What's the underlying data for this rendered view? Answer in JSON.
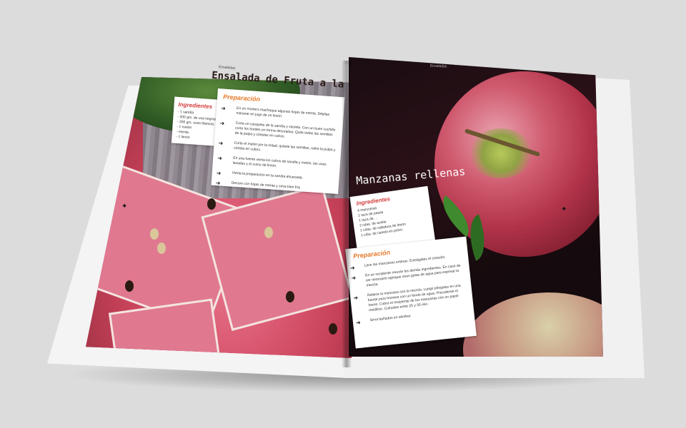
{
  "left_page": {
    "section_tag": "Ensaladas",
    "title": "Ensalada de Fruta a la Menta",
    "ingredients_heading": "Ingredientes",
    "ingredients": [
      "- 1 sandía",
      "- 200 grs. de uva negras",
      "- 200 grs. uvas blancas",
      "- 1 melón",
      "- menta",
      "- 1 limón"
    ],
    "preparation_heading": "Preparación",
    "steps": [
      "En un mortero machaque algunas hojas de menta. Déjelas macerar en jugo de un limón.",
      "Corte un casquete de la sandía y vacíela. Con un buen cuchillo corte los bordes en forma decorativa. Quite todas las semillas de la pulpa y córtelas en cubos.",
      "Corte el melón por la mitad, quítele las semillas, retire la pulpa y córtela en cubos.",
      "En una fuente vierta los cubos de sandía y melón, las uvas lavadas y el zumo de limón.",
      "Vierta la preparación en la sandía ahuecada.",
      "Decore con hojas de menta y sirva bien fría"
    ]
  },
  "right_page": {
    "section_tag": "Ensaladas",
    "title": "Manzanas rellenas",
    "ingredients_heading": "Ingredientes",
    "ingredients": [
      "4 manzanas",
      "1 taza de pasas",
      "1 taza de ...",
      "2 cdas. de aceite",
      "1 cdas. de ralladura de limón",
      "1 cdta. de canela en polvo."
    ],
    "preparation_heading": "Preparación",
    "steps": [
      "Lave las manzanas enteras. Extráigales el corazón.",
      "En un recipiente mezcle los demás ingredientes. En caso de ser necesario agregue unas gotas de agua para espesar la mezcla.",
      "Rellene la manzana con la mezcla. Luego póngalas en una fuente para hornear con un fondo de agua. Precaliente el horno. Cubra el recipiente de las manzanas con un papel metálico. Cuézalas entre 25 y 35 min.",
      "Sirva bañadas en almíbar."
    ]
  },
  "colors": {
    "background": "#dcdcdc",
    "accent_orange": "#e4792a",
    "accent_red": "#d33b3b",
    "watermelon": "#e07890",
    "apple_red": "#b1334a"
  }
}
